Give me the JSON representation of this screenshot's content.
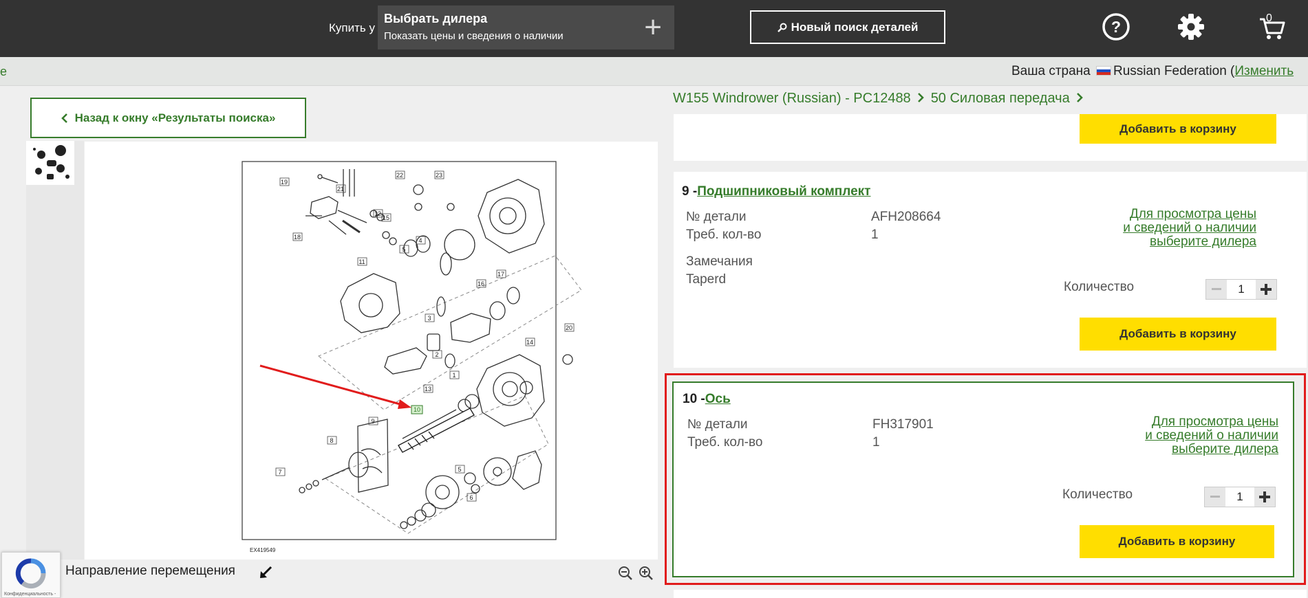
{
  "header": {
    "buy_from": "Купить у",
    "dealer_title": "Выбрать дилера",
    "dealer_subtitle": "Показать цены и сведения о наличии",
    "new_search": "Новый поиск деталей",
    "cart_count": "0"
  },
  "country_bar": {
    "prefix": "Ваша страна",
    "country": "Russian Federation (",
    "change": "Изменить",
    "left_fragment": "е"
  },
  "left": {
    "back_button": "Назад к окну «Результаты поиска»",
    "diagram_code": "EX419549",
    "nav_label": "Направление перемещения",
    "recaptcha_privacy": "Конфиденциальность - "
  },
  "breadcrumb": [
    {
      "label": "W155 Windrower (Russian) - PC12488"
    },
    {
      "label": "50 Силовая передача"
    }
  ],
  "parts": [
    {
      "add_label": "Добавить в корзину"
    },
    {
      "number": "9 -",
      "name": "Подшипниковый комплект",
      "part_no_label": "№ детали",
      "part_no": "AFH208664",
      "qty_label": "Треб. кол-во",
      "qty": "1",
      "remarks_label": "Замечания",
      "remarks": "Taperd",
      "price_link": "Для просмотра цены и сведений о наличии выберите дилера",
      "quantity_label": "Количество",
      "quantity": "1",
      "add_label": "Добавить в корзину"
    },
    {
      "number": "10 -",
      "name": "Ось",
      "part_no_label": "№ детали",
      "part_no": "FH317901",
      "qty_label": "Треб. кол-во",
      "qty": "1",
      "price_link": "Для просмотра цены и сведений о наличии выберите дилера",
      "quantity_label": "Количество",
      "quantity": "1",
      "add_label": "Добавить в корзину"
    }
  ],
  "diagram_callouts": [
    "19",
    "21",
    "22",
    "23",
    "12",
    "15",
    "18",
    "11",
    "5",
    "4",
    "16",
    "17",
    "3",
    "2",
    "20",
    "14",
    "13",
    "10",
    "1",
    "9",
    "8",
    "7",
    "6"
  ],
  "colors": {
    "header_bg": "#333333",
    "brand_green": "#367c2b",
    "add_yellow": "#ffde00",
    "highlight_red": "#e11c1c"
  }
}
